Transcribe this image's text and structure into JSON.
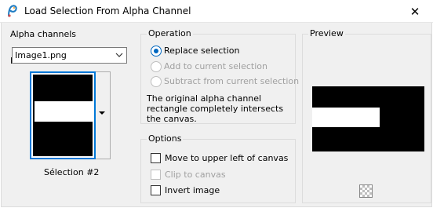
{
  "window": {
    "title": "Load Selection From Alpha Channel",
    "close_glyph": "✕"
  },
  "alpha_channels": {
    "title": "Alpha channels",
    "load_from_label": "Load from document:",
    "document_value": "Image1.png",
    "selection_caption": "Sélection #2"
  },
  "operation": {
    "title": "Operation",
    "options": [
      {
        "label": "Replace selection",
        "checked": true,
        "enabled": true
      },
      {
        "label": "Add to current selection",
        "checked": false,
        "enabled": false
      },
      {
        "label": "Subtract from current selection",
        "checked": false,
        "enabled": false
      }
    ],
    "info": "The original alpha channel rectangle completely intersects the canvas."
  },
  "options": {
    "title": "Options",
    "items": [
      {
        "label": "Move to upper left of canvas",
        "checked": false,
        "enabled": true
      },
      {
        "label": "Clip to canvas",
        "checked": false,
        "enabled": false
      },
      {
        "label": "Invert image",
        "checked": false,
        "enabled": true
      }
    ]
  },
  "preview": {
    "title": "Preview"
  },
  "icons": {
    "app": "paintshop-pro-icon",
    "close": "close-icon",
    "dropdown": "chevron-down-icon",
    "transparency": "checkerboard-icon"
  },
  "colors": {
    "accent": "#0067c0",
    "focus": "#0078d7",
    "panel": "#f0f0f0",
    "border": "#dcdcdc",
    "disabled_text": "#a0a0a0"
  }
}
